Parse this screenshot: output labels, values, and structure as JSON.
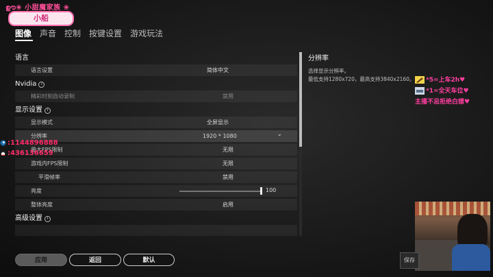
{
  "stream_badge": {
    "line1": "ഊ❀ 小甜魔家族 ❀",
    "line2": "小船"
  },
  "tabs": [
    "图像",
    "声音",
    "控制",
    "按键设置",
    "游戏玩法"
  ],
  "sections": {
    "language": "语言",
    "nvidia": "Nvidia",
    "display": "显示设置",
    "advanced": "高级设置"
  },
  "rows": {
    "language_setting": {
      "label": "语言设置",
      "value": "简体中文"
    },
    "highlights": {
      "label": "精彩时刻自动录制",
      "value": "禁用"
    },
    "display_mode": {
      "label": "显示模式",
      "value": "全屏显示"
    },
    "resolution": {
      "label": "分辨率",
      "value": "1920 * 1080"
    },
    "fps_limit": {
      "label": "最大FPS限制",
      "value": "无限"
    },
    "ingame_fps": {
      "label": "游戏内FPS限制",
      "value": "无限"
    },
    "smooth_fps": {
      "label": "平滑帧率",
      "value": "禁用"
    },
    "brightness": {
      "label": "亮度",
      "value": "100"
    },
    "overall_brightness": {
      "label": "整体亮度",
      "value": "启用"
    }
  },
  "description": {
    "title": "分辨率",
    "line1": "选择显示分辨率。",
    "line2": "最低支持1280x720，最高支持3840x2160。"
  },
  "buttons": {
    "apply": "应用",
    "back": "返回",
    "default": "默认"
  },
  "overlay_left": {
    "line1": ":1144896888",
    "line2": ":436136659"
  },
  "overlay_right": {
    "note1": "*5=上车2h♥",
    "note2": "*1=全天车位♥",
    "note3": "主播不忌拒绝白嫖♥"
  },
  "save_label": "保存",
  "colors": {
    "accent_pink": "#ff3fa0",
    "scroll_thumb": "#bdbdbd"
  }
}
